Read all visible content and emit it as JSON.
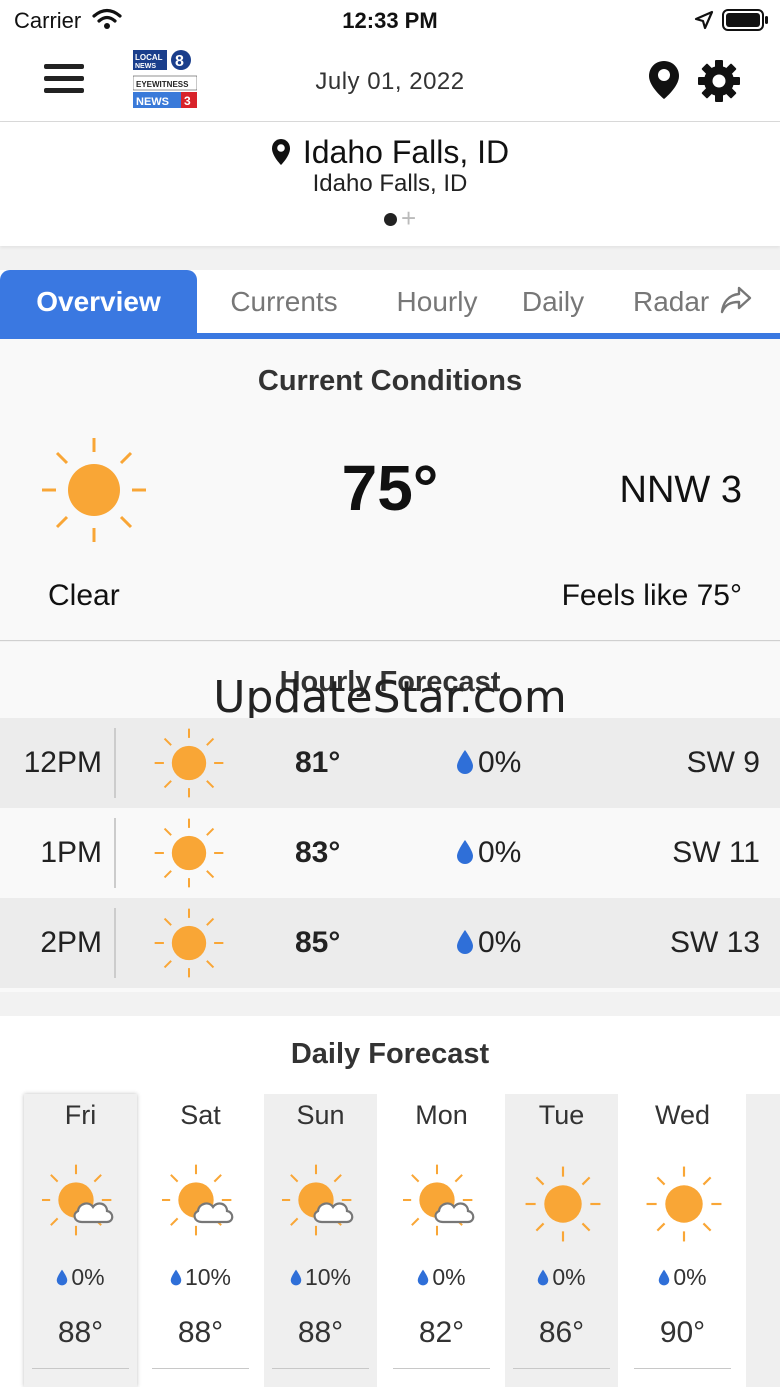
{
  "status_bar": {
    "carrier": "Carrier",
    "time": "12:33 PM"
  },
  "nav": {
    "date": "July 01, 2022",
    "logo_text": [
      "LOCAL",
      "NEWS 8",
      "EYEWITNESS",
      "NEWS 3"
    ]
  },
  "location": {
    "title": "Idaho Falls, ID",
    "subtitle": "Idaho Falls, ID"
  },
  "tabs": [
    "Overview",
    "Currents",
    "Hourly",
    "Daily",
    "Radar"
  ],
  "current": {
    "title": "Current Conditions",
    "temp": "75°",
    "wind": "NNW 3",
    "condition": "Clear",
    "feels_like": "Feels like 75°",
    "icon": "sun-icon"
  },
  "hourly": {
    "title": "Hourly Forecast",
    "watermark": "UpdateStar.com",
    "rows": [
      {
        "time": "12PM",
        "temp": "81°",
        "precip": "0%",
        "wind": "SW 9",
        "icon": "sun-icon"
      },
      {
        "time": "1PM",
        "temp": "83°",
        "precip": "0%",
        "wind": "SW 11",
        "icon": "sun-icon"
      },
      {
        "time": "2PM",
        "temp": "85°",
        "precip": "0%",
        "wind": "SW 13",
        "icon": "sun-icon"
      }
    ]
  },
  "daily": {
    "title": "Daily Forecast",
    "days": [
      {
        "day": "Fri",
        "precip": "0%",
        "temp": "88°",
        "icon": "partly-cloudy-icon"
      },
      {
        "day": "Sat",
        "precip": "10%",
        "temp": "88°",
        "icon": "partly-cloudy-icon"
      },
      {
        "day": "Sun",
        "precip": "10%",
        "temp": "88°",
        "icon": "partly-cloudy-icon"
      },
      {
        "day": "Mon",
        "precip": "0%",
        "temp": "82°",
        "icon": "partly-cloudy-icon"
      },
      {
        "day": "Tue",
        "precip": "0%",
        "temp": "86°",
        "icon": "sun-icon"
      },
      {
        "day": "Wed",
        "precip": "0%",
        "temp": "90°",
        "icon": "sun-icon"
      }
    ]
  },
  "colors": {
    "accent": "#3a78e1",
    "sun": "#f9a636",
    "drop": "#2f6fd8"
  }
}
